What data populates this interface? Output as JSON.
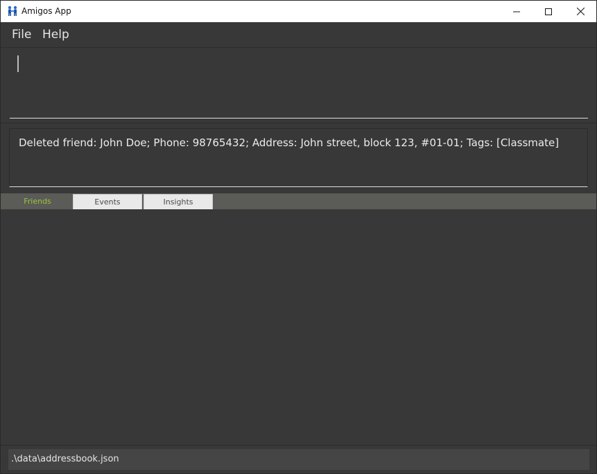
{
  "window": {
    "title": "Amigos App",
    "icon": "app-logo-icon",
    "controls": [
      "minimize-icon",
      "maximize-icon",
      "close-icon"
    ]
  },
  "menu": {
    "file": "File",
    "help": "Help"
  },
  "command": {
    "value": "",
    "placeholder": ""
  },
  "result": {
    "text": "Deleted friend: John Doe; Phone: 98765432; Address: John street, block 123, #01-01; Tags: [Classmate]"
  },
  "tabs": [
    {
      "label": "Friends",
      "selected": true
    },
    {
      "label": "Events",
      "selected": false
    },
    {
      "label": "Insights",
      "selected": false
    }
  ],
  "status": {
    "path": ".\\data\\addressbook.json"
  },
  "colors": {
    "background": "#383838",
    "tab_selected_text": "#9bc53d",
    "tab_bar": "#5b5b57",
    "text": "#ececec"
  }
}
